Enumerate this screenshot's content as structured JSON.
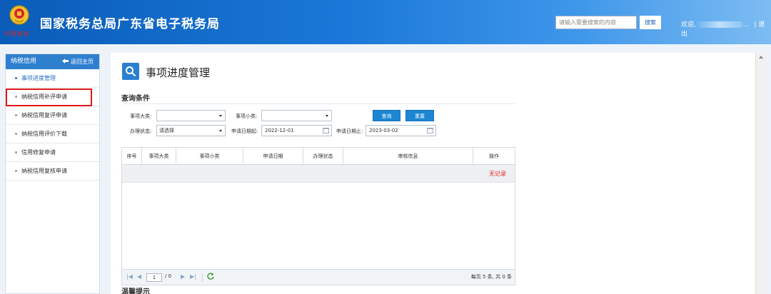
{
  "header": {
    "title": "国家税务总局广东省电子税务局",
    "emblem_text": "中国税务",
    "search": {
      "placeholder": "请输入需要搜索的内容",
      "button": "搜索"
    },
    "welcome": "欢迎,",
    "welcome_tail": "...",
    "logout": "| 退出"
  },
  "sidebar": {
    "title": "纳税信用",
    "back_home": "返回主页",
    "items": [
      {
        "label": "事项进度管理"
      },
      {
        "label": "纳税信用补评申请"
      },
      {
        "label": "纳税信用复评申请"
      },
      {
        "label": "纳税信用评价下载"
      },
      {
        "label": "信用修复申请"
      },
      {
        "label": "纳税信用复核申请"
      }
    ]
  },
  "main": {
    "page_title": "事项进度管理",
    "query_section": "查询条件",
    "filters": {
      "major_label": "事项大类:",
      "major_value": "",
      "minor_label": "事项小类:",
      "minor_value": "",
      "status_label": "办理状态:",
      "status_value": "请选择",
      "date_from_label": "申请日期起:",
      "date_from": "2022-12-01",
      "date_to_label": "申请日期止:",
      "date_to": "2023-03-02"
    },
    "buttons": {
      "query": "查询",
      "reset": "重置"
    },
    "table": {
      "columns": [
        "序号",
        "事项大类",
        "事项小类",
        "申请日期",
        "办理状态",
        "审核信息",
        "操作"
      ],
      "empty_text": "无记录"
    },
    "pager": {
      "page": "1",
      "total_pages": "/ 0",
      "info": "每页 5 条, 共 0 条"
    },
    "tips_title": "温馨提示"
  }
}
